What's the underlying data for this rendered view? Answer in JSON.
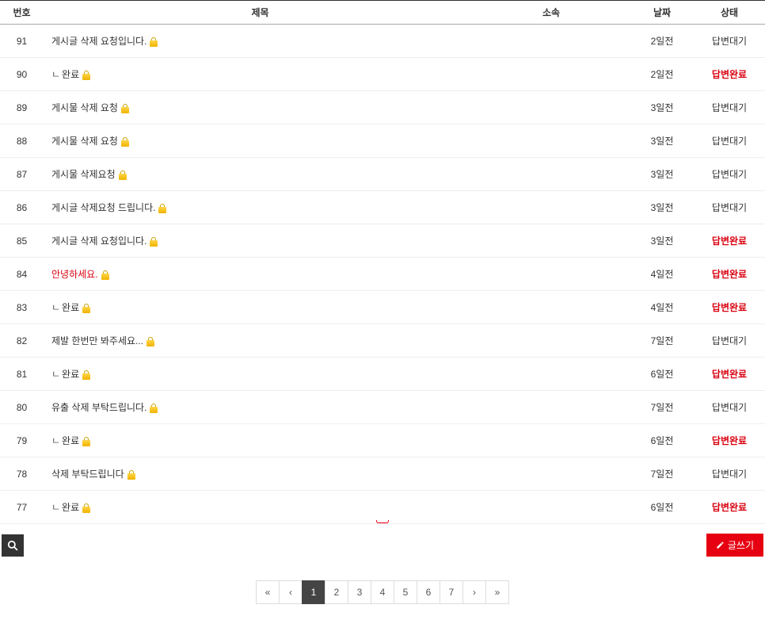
{
  "headers": {
    "no": "번호",
    "title": "제목",
    "affil": "소속",
    "date": "날짜",
    "status": "상태"
  },
  "status_labels": {
    "pending": "답변대기",
    "complete": "답변완료"
  },
  "rows": [
    {
      "no": "91",
      "title": "게시글 삭제 요청입니다.",
      "reply": false,
      "red": false,
      "date": "2일전",
      "status": "pending"
    },
    {
      "no": "90",
      "title": "완료",
      "reply": true,
      "red": false,
      "date": "2일전",
      "status": "complete"
    },
    {
      "no": "89",
      "title": "게시물 삭제 요청",
      "reply": false,
      "red": false,
      "date": "3일전",
      "status": "pending"
    },
    {
      "no": "88",
      "title": "게시물 삭제 요청",
      "reply": false,
      "red": false,
      "date": "3일전",
      "status": "pending"
    },
    {
      "no": "87",
      "title": "게시물 삭제요청",
      "reply": false,
      "red": false,
      "date": "3일전",
      "status": "pending"
    },
    {
      "no": "86",
      "title": "게시글 삭제요청 드립니다.",
      "reply": false,
      "red": false,
      "date": "3일전",
      "status": "pending"
    },
    {
      "no": "85",
      "title": "게시글 삭제 요청입니다.",
      "reply": false,
      "red": false,
      "date": "3일전",
      "status": "complete"
    },
    {
      "no": "84",
      "title": "안녕하세요.",
      "reply": false,
      "red": true,
      "date": "4일전",
      "status": "complete"
    },
    {
      "no": "83",
      "title": "완료",
      "reply": true,
      "red": false,
      "date": "4일전",
      "status": "complete"
    },
    {
      "no": "82",
      "title": "제발 한번만 봐주세요...",
      "reply": false,
      "red": false,
      "date": "7일전",
      "status": "pending"
    },
    {
      "no": "81",
      "title": "완료",
      "reply": true,
      "red": false,
      "date": "6일전",
      "status": "complete"
    },
    {
      "no": "80",
      "title": "유출 삭제 부탁드립니다.",
      "reply": false,
      "red": false,
      "date": "7일전",
      "status": "pending"
    },
    {
      "no": "79",
      "title": "완료",
      "reply": true,
      "red": false,
      "date": "6일전",
      "status": "complete"
    },
    {
      "no": "78",
      "title": "삭제 부탁드립니다",
      "reply": false,
      "red": false,
      "date": "7일전",
      "status": "pending"
    },
    {
      "no": "77",
      "title": "완료",
      "reply": true,
      "red": false,
      "date": "6일전",
      "status": "complete"
    }
  ],
  "buttons": {
    "write": "글쓰기"
  },
  "pagination": {
    "first": "«",
    "prev": "‹",
    "next": "›",
    "last": "»",
    "pages": [
      "1",
      "2",
      "3",
      "4",
      "5",
      "6",
      "7"
    ],
    "active": "1"
  }
}
